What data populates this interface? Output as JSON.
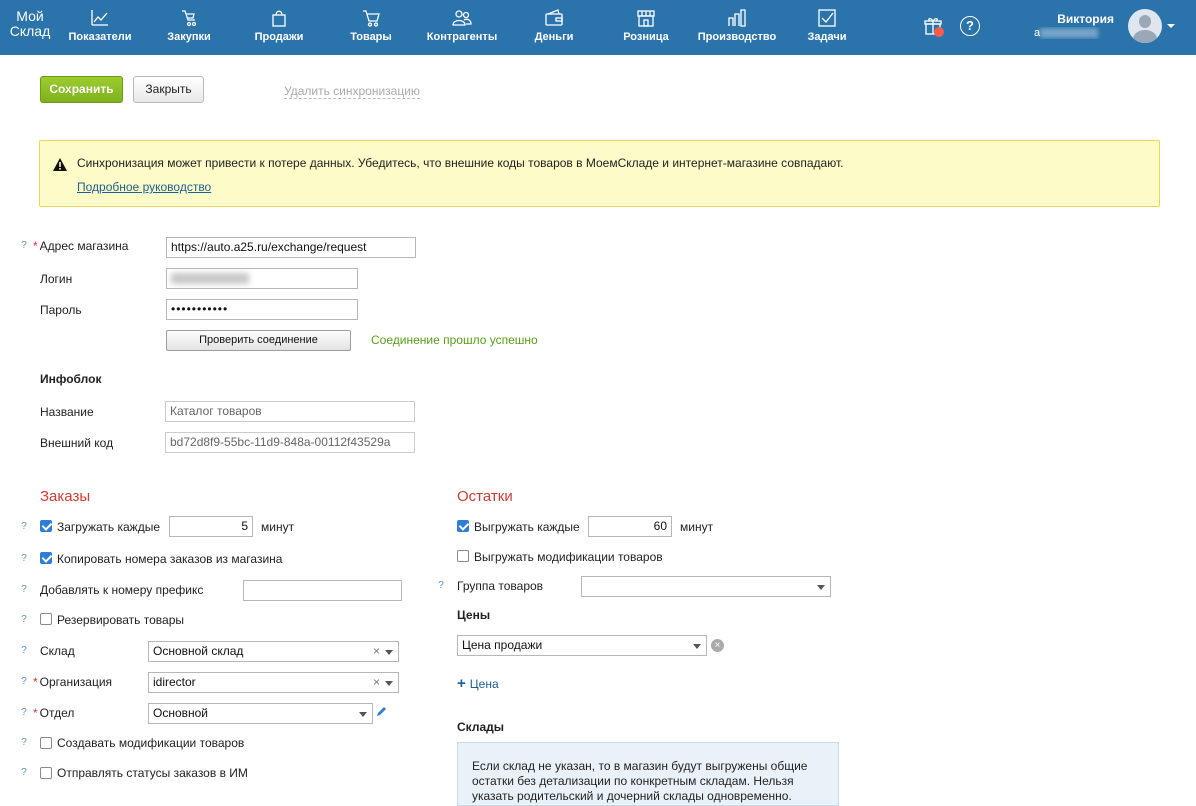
{
  "nav": {
    "logo": "Мой Склад",
    "items": [
      {
        "label": "Показатели",
        "icon": "chart-line-icon"
      },
      {
        "label": "Закупки",
        "icon": "cart-hand-icon"
      },
      {
        "label": "Продажи",
        "icon": "shopping-bag-icon"
      },
      {
        "label": "Товары",
        "icon": "cart-icon"
      },
      {
        "label": "Контрагенты",
        "icon": "people-icon"
      },
      {
        "label": "Деньги",
        "icon": "wallet-icon"
      },
      {
        "label": "Розница",
        "icon": "store-icon"
      },
      {
        "label": "Производство",
        "icon": "factory-icon"
      },
      {
        "label": "Задачи",
        "icon": "task-check-icon"
      }
    ],
    "user_name": "Виктория",
    "user_mail_prefix": "a"
  },
  "toolbar": {
    "save_label": "Сохранить",
    "close_label": "Закрыть",
    "delete_sync_label": "Удалить синхронизацию"
  },
  "warning": {
    "text": "Синхронизация может привести к потере данных. Убедитесь, что внешние коды товаров в МоемСкладе и интернет-магазине совпадают.",
    "link": "Подробное руководство"
  },
  "connection": {
    "address_label": "Адрес магазина",
    "address_value": "https://auto.a25.ru/exchange/request",
    "login_label": "Логин",
    "password_label": "Пароль",
    "password_value": "•••••••••••",
    "check_button": "Проверить соединение",
    "status": "Соединение прошло успешно"
  },
  "infoblock": {
    "title": "Инфоблок",
    "name_label": "Название",
    "name_value": "Каталог товаров",
    "ext_code_label": "Внешний код",
    "ext_code_value": "bd72d8f9-55bc-11d9-848a-00112f43529a"
  },
  "orders": {
    "title": "Заказы",
    "load_every_label": "Загружать каждые",
    "load_every_value": "5",
    "load_every_unit": "минут",
    "load_every_checked": true,
    "copy_numbers_label": "Копировать номера заказов из магазина",
    "copy_numbers_checked": true,
    "prefix_label": "Добавлять к номеру префикс",
    "prefix_value": "",
    "reserve_label": "Резервировать товары",
    "reserve_checked": false,
    "warehouse_label": "Склад",
    "warehouse_value": "Основной склад",
    "org_label": "Организация",
    "org_value": "idirector",
    "dept_label": "Отдел",
    "dept_value": "Основной",
    "create_mods_label": "Создавать модификации товаров",
    "create_mods_checked": false,
    "send_status_label": "Отправлять статусы заказов в ИМ",
    "send_status_checked": false
  },
  "stock": {
    "title": "Остатки",
    "export_every_label": "Выгружать каждые",
    "export_every_value": "60",
    "export_every_unit": "минут",
    "export_every_checked": true,
    "export_mods_label": "Выгружать модификации товаров",
    "export_mods_checked": false,
    "group_label": "Группа товаров",
    "group_value": "",
    "prices_title": "Цены",
    "price_value": "Цена продажи",
    "add_price_label": "Цена",
    "warehouses_title": "Склады",
    "warehouses_info": "Если склад не указан, то в магазин будут выгружены общие остатки без детализации по конкретным складам. Нельзя указать родительский и дочерний склады одновременно."
  },
  "colors": {
    "nav_bg": "#2b73ab",
    "save_green": "#8cbf24",
    "section_red": "#d03c34",
    "success_green": "#5a9e19",
    "link_blue": "#1d5f96",
    "warning_bg": "#fdfbc7"
  }
}
